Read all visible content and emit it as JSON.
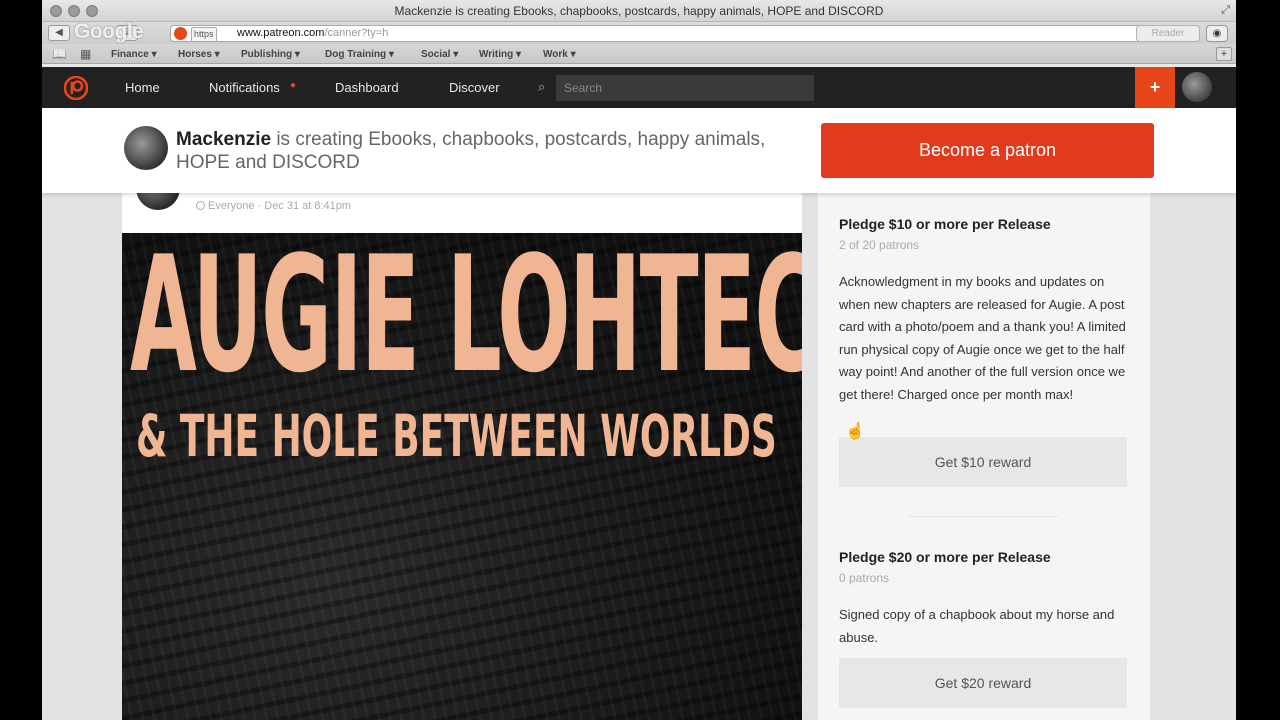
{
  "window": {
    "title": "Mackenzie is creating Ebooks, chapbooks, postcards, happy animals, HOPE and DISCORD",
    "watermark": "Google"
  },
  "address_bar": {
    "protocol": "https",
    "host": "www.patreon.com",
    "path": "/canner?ty=h",
    "reader_label": "Reader"
  },
  "bookmarks": [
    "Finance ▾",
    "Horses ▾",
    "Publishing ▾",
    "Dog Training ▾",
    "Social ▾",
    "Writing ▾",
    "Work ▾"
  ],
  "nav": {
    "home": "Home",
    "notifications": "Notifications",
    "notification_dot": "●",
    "dashboard": "Dashboard",
    "discover": "Discover",
    "search_placeholder": "Search",
    "plus": "+"
  },
  "creator": {
    "name": "Mackenzie",
    "tagline": " is creating Ebooks, chapbooks, postcards, happy animals, HOPE and DISCORD",
    "become_patron_label": "Become a patron"
  },
  "post": {
    "meta": "Everyone · Dec 31 at 8:41pm",
    "cover_title": "AUGIE LOHTECH",
    "cover_subtitle": "& THE HOLE BETWEEN WORLDS"
  },
  "tiers": [
    {
      "title": "Pledge $10 or more per Release",
      "patrons": "2 of 20 patrons",
      "description": "Acknowledgment in my books and updates on when new chapters are released for Augie. A post card with a photo/poem and a thank you! A limited run physical copy of Augie once we get to the half way point! And another of the full version once we get there! Charged once per month max!",
      "button": "Get $10 reward"
    },
    {
      "title": "Pledge $20 or more per Release",
      "patrons": "0 patrons",
      "description": "Signed copy of a chapbook about my horse and abuse.",
      "button": "Get $20 reward"
    }
  ],
  "colors": {
    "brand": "#e13a1d",
    "nav_bg": "#222222",
    "cover_text": "#f0b593"
  },
  "icons": [
    "patreon-logo-icon",
    "search-icon",
    "globe-icon",
    "plus-icon",
    "cursor-icon"
  ]
}
